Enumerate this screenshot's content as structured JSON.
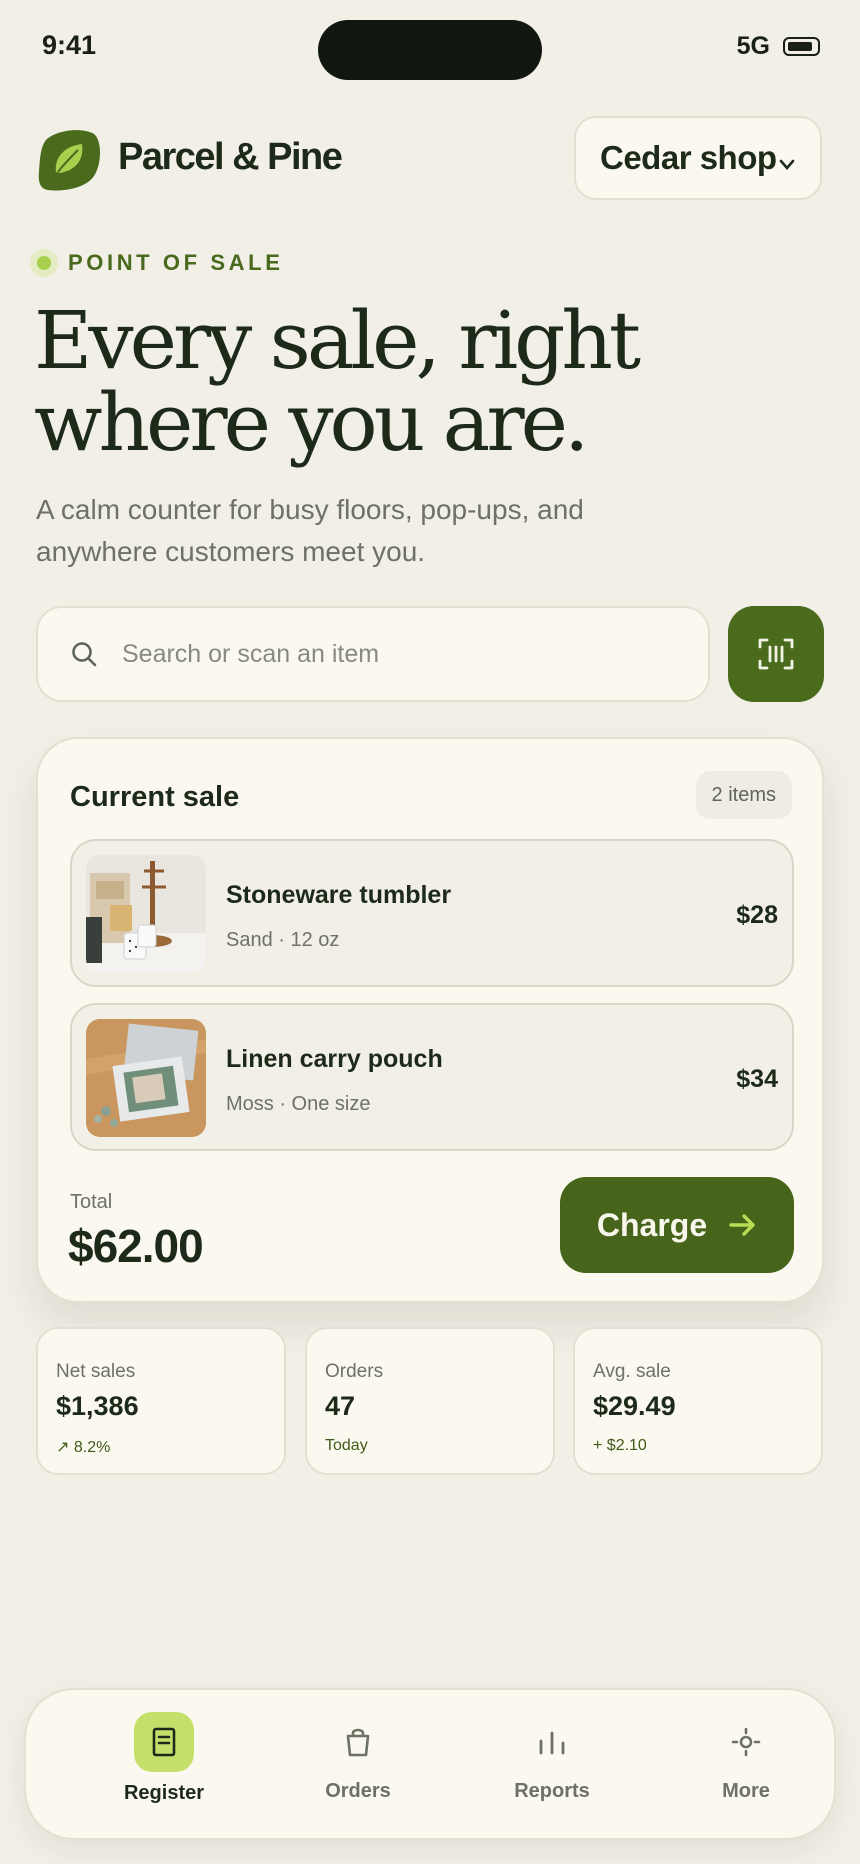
{
  "status_bar": {
    "time": "9:41",
    "network": "5G"
  },
  "header": {
    "brand": "Parcel & Pine",
    "shop_selector": "Cedar shop"
  },
  "hero": {
    "eyebrow": "POINT OF SALE",
    "title": "Every sale, right where you are.",
    "subtitle": "A calm counter for busy floors, pop-ups, and anywhere customers meet you."
  },
  "search": {
    "placeholder": "Search or scan an item"
  },
  "sale": {
    "title": "Current sale",
    "count": "2 items",
    "items": [
      {
        "name": "Stoneware tumbler",
        "meta": "Sand · 12 oz",
        "price": "$28"
      },
      {
        "name": "Linen carry pouch",
        "meta": "Moss · One size",
        "price": "$34"
      }
    ],
    "total_label": "Total",
    "total": "$62.00",
    "charge_label": "Charge"
  },
  "stats": [
    {
      "label": "Net sales",
      "value": "$1,386",
      "note": "↗ 8.2%"
    },
    {
      "label": "Orders",
      "value": "47",
      "note": "Today"
    },
    {
      "label": "Avg. sale",
      "value": "$29.49",
      "note": "+ $2.10"
    }
  ],
  "tabs": [
    {
      "label": "Register",
      "icon": "receipt-icon",
      "active": true
    },
    {
      "label": "Orders",
      "icon": "bag-icon"
    },
    {
      "label": "Reports",
      "icon": "bar-chart-icon"
    },
    {
      "label": "More",
      "icon": "more-icon"
    }
  ],
  "colors": {
    "background": "#f1efe6",
    "accent": "#4b6b1c",
    "highlight": "#c5e06a",
    "text": "#1d2a1a"
  }
}
